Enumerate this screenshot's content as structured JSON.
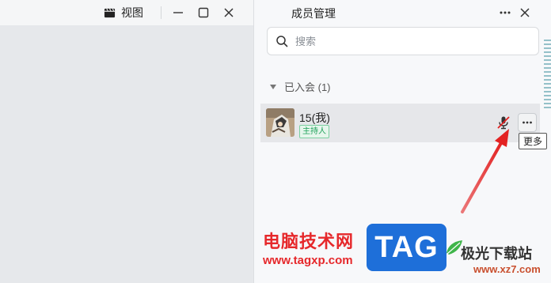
{
  "toolbar": {
    "view_label": "视图",
    "view_icon": "clapperboard-icon",
    "minimize_icon": "minimize-icon",
    "maximize_icon": "maximize-icon",
    "close_icon": "close-icon"
  },
  "panel": {
    "title": "成员管理",
    "more_icon": "more-horizontal-icon",
    "close_icon": "close-icon",
    "search": {
      "placeholder": "搜索",
      "value": ""
    },
    "group": {
      "label": "已入会 (1)",
      "collapsed": false
    },
    "members": [
      {
        "name": "15(我)",
        "badge": "主持人",
        "mic": "muted",
        "more_tooltip": "更多"
      }
    ]
  },
  "colors": {
    "host_badge": "#21a25c",
    "annotation_arrow": "#e32222",
    "panel_bg": "#f7f8fa"
  },
  "watermark": {
    "cn_text": "电脑技术网",
    "url": "www.tagxp.com",
    "logo_text": "TAG",
    "site_name": "极光下载站",
    "site_url": "www.xz7.com"
  }
}
